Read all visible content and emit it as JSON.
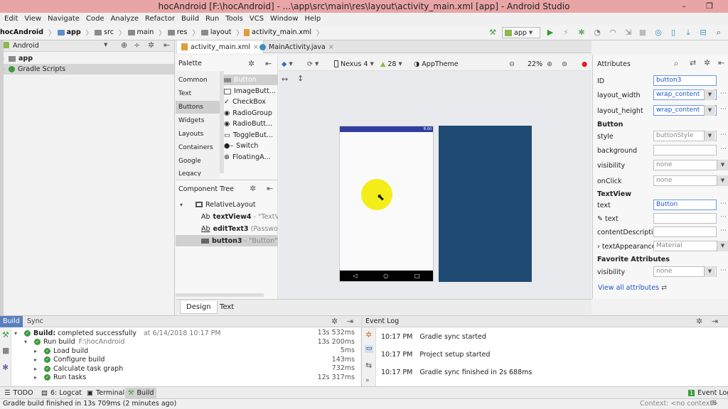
{
  "window": {
    "title": "hocAndroid [F:\\hocAndroid] - ...\\app\\src\\main\\res\\layout\\activity_main.xml [app] - Android Studio"
  },
  "menu": [
    "Edit",
    "View",
    "Navigate",
    "Code",
    "Analyze",
    "Refactor",
    "Build",
    "Run",
    "Tools",
    "VCS",
    "Window",
    "Help"
  ],
  "breadcrumbs": [
    "hocAndroid",
    "app",
    "src",
    "main",
    "res",
    "layout",
    "activity_main.xml"
  ],
  "toolbar": {
    "run_config": "app"
  },
  "project": {
    "view": "Android",
    "items": [
      {
        "label": "app"
      },
      {
        "label": "Gradle Scripts"
      }
    ]
  },
  "editor_tabs": [
    {
      "label": "activity_main.xml"
    },
    {
      "label": "MainActivity.java"
    }
  ],
  "palette": {
    "title": "Palette",
    "categories": [
      "Common",
      "Text",
      "Buttons",
      "Widgets",
      "Layouts",
      "Containers",
      "Google",
      "Legacy"
    ],
    "selected_category": "Buttons",
    "items": [
      "Button",
      "ImageButt...",
      "CheckBox",
      "RadioGroup",
      "RadioButt...",
      "ToggleBut...",
      "Switch",
      "FloatingA..."
    ]
  },
  "component_tree": {
    "title": "Component Tree",
    "root": "RelativeLayout",
    "items": [
      {
        "id": "textView4",
        "hint": "- \"TextView\""
      },
      {
        "id": "editText3",
        "hint": "(Password)"
      },
      {
        "id": "button3",
        "hint": "- \"Button\""
      }
    ]
  },
  "design_toolbar": {
    "device": "Nexus 4",
    "api": "28",
    "theme": "AppTheme",
    "zoom": "22%"
  },
  "phone": {
    "status_time": "8:00"
  },
  "attributes": {
    "title": "Attributes",
    "id_label": "ID",
    "id_value": "button3",
    "layout_width_label": "layout_width",
    "layout_width_value": "wrap_content",
    "layout_height_label": "layout_height",
    "layout_height_value": "wrap_content",
    "section_button": "Button",
    "style_label": "style",
    "style_value": "buttonStyle",
    "background_label": "background",
    "visibility_label": "visibility",
    "visibility_value": "none",
    "onclick_label": "onClick",
    "onclick_value": "none",
    "section_textview": "TextView",
    "text_label": "text",
    "text_value": "Button",
    "text_tools_label": "text",
    "contentdesc_label": "contentDescriptio",
    "textappearance_label": "textAppearance",
    "textappearance_value": "Material",
    "section_favorite": "Favorite Attributes",
    "fav_visibility_label": "visibility",
    "fav_visibility_value": "none",
    "view_all": "View all attributes"
  },
  "design_tabs": [
    "Design",
    "Text"
  ],
  "build": {
    "tabs": [
      "Build",
      "Sync"
    ],
    "lines": [
      {
        "text": "Build:",
        "detail": "completed successfully",
        "extra": "at 6/14/2018 10:17 PM",
        "time": "13s 532ms"
      },
      {
        "text": "Run build",
        "extra": "F:\\hocAndroid",
        "time": "13s 200ms"
      },
      {
        "text": "Load build",
        "time": "5ms"
      },
      {
        "text": "Configure build",
        "time": "143ms"
      },
      {
        "text": "Calculate task graph",
        "time": "732ms"
      },
      {
        "text": "Run tasks",
        "time": "12s 317ms"
      }
    ]
  },
  "event_log": {
    "title": "Event Log",
    "entries": [
      {
        "time": "10:17 PM",
        "msg": "Gradle sync started"
      },
      {
        "time": "10:17 PM",
        "msg": "Project setup started"
      },
      {
        "time": "10:17 PM",
        "msg": "Gradle sync finished in 2s 688ms"
      }
    ]
  },
  "toolwindows": {
    "todo": "TODO",
    "logcat": "6: Logcat",
    "terminal": "Terminal",
    "build": "Build",
    "event_log_badge": "1",
    "event_log": "Event Log"
  },
  "status": {
    "message": "Gradle build finished in 13s 709ms (2 minutes ago)",
    "context": "Context: <no context>"
  }
}
